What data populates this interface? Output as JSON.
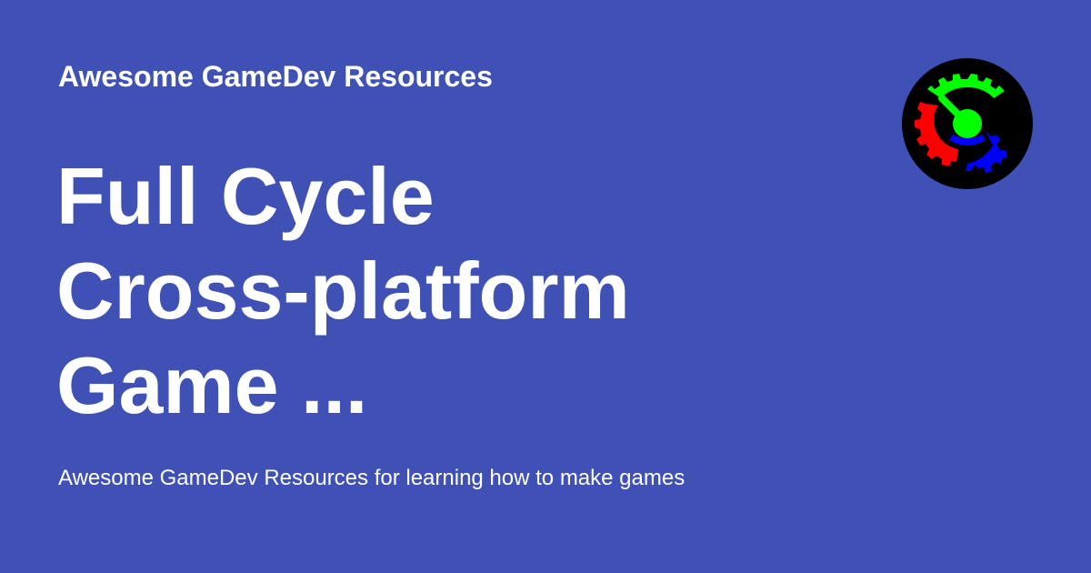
{
  "site": {
    "name": "Awesome GameDev Resources"
  },
  "page": {
    "title_lines": [
      "Full Cycle",
      "Cross-platform",
      "Game ..."
    ],
    "description": "Awesome GameDev Resources for learning how to make games"
  },
  "logo": {
    "icon": "gears-logo-icon",
    "colors": {
      "background": "#000000",
      "gear_top": "#00ff00",
      "gear_left": "#ff0000",
      "gear_right": "#0000ff"
    }
  },
  "theme": {
    "background": "#3f51b5",
    "text": "#ffffff"
  }
}
